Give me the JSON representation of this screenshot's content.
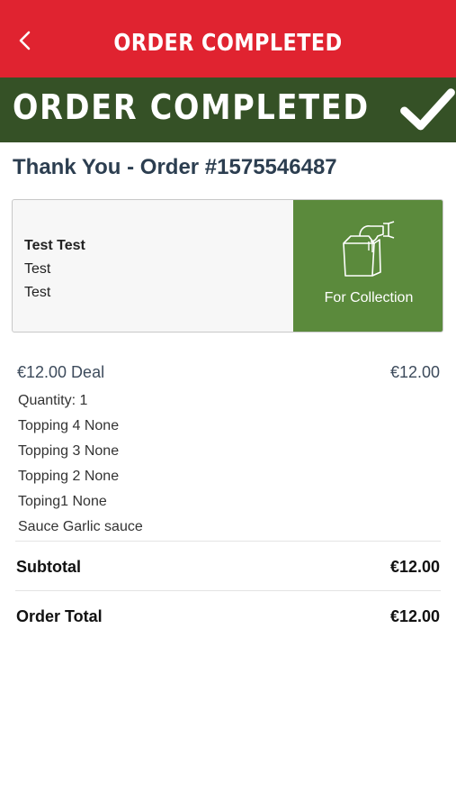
{
  "nav": {
    "title": "ORDER COMPLETED"
  },
  "banner": {
    "text": "ORDER COMPLETED"
  },
  "order": {
    "heading": "Thank You - Order #1575546487"
  },
  "customer": {
    "name": "Test Test",
    "line1": "Test",
    "line2": "Test"
  },
  "delivery": {
    "label": "For Collection"
  },
  "item": {
    "title": "€12.00 Deal",
    "price": "€12.00",
    "details": [
      "Quantity: 1",
      "Topping 4 None",
      "Topping 3 None",
      "Topping 2 None",
      "Toping1 None",
      "Sauce Garlic sauce"
    ]
  },
  "totals": {
    "subtotal_label": "Subtotal",
    "subtotal_value": "€12.00",
    "total_label": "Order Total",
    "total_value": "€12.00"
  },
  "icons": {
    "back": "chevron-left-icon",
    "check": "checkmark-icon",
    "collection": "hand-bag-icon"
  },
  "colors": {
    "nav_red": "#e02330",
    "banner_green": "#355126",
    "collection_green": "#5b8a3c"
  }
}
